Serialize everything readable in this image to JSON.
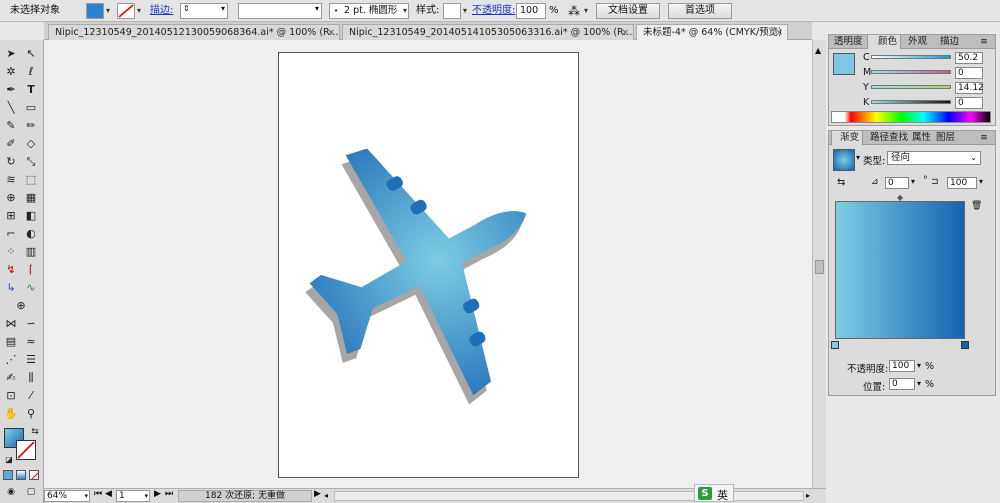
{
  "control_bar": {
    "selection_status": "未选择对象",
    "stroke_label": "描边:",
    "stroke_weight": "",
    "brush_value": "2 pt. 椭圆形",
    "style_label": "样式:",
    "opacity_label": "不透明度:",
    "opacity_value": "100",
    "opacity_unit": "%",
    "doc_setup_button": "文档设置",
    "preferences_button": "首选项"
  },
  "tabs": [
    {
      "label": "Nipic_12310549_20140512130059068364.ai* @ 100% (R...",
      "close": "×"
    },
    {
      "label": "Nipic_12310549_20140514105305063316.ai* @ 100% (R...",
      "close": "×"
    },
    {
      "label": "未标题-4* @ 64% (CMYK/预览)",
      "close": "×"
    }
  ],
  "color_panel": {
    "tabs": [
      "透明度",
      "颜色",
      "外观",
      "描边"
    ],
    "swatch_color": "#7ec8e3",
    "channels": [
      {
        "label": "C",
        "value": "50.2"
      },
      {
        "label": "M",
        "value": "0"
      },
      {
        "label": "Y",
        "value": "14.12"
      },
      {
        "label": "K",
        "value": "0"
      }
    ]
  },
  "gradient_panel": {
    "tabs": [
      "渐变",
      "路径查找",
      "属性",
      "图层"
    ],
    "type_label": "类型:",
    "type_value": "径向",
    "angle_value": "0",
    "degree_unit": "°",
    "aspect_value": "100",
    "opacity_label": "不透明度:",
    "opacity_value": "100",
    "position_label": "位置:",
    "position_value": "0",
    "percent": "%",
    "stop_start_color": "#7ecde3",
    "stop_end_color": "#1563b0"
  },
  "status_bar": {
    "zoom": "64%",
    "page": "1",
    "undo_status": "182 次还原; 无重做"
  },
  "ime": {
    "logo": "S",
    "mode": "英"
  },
  "colors": {
    "plane_light": "#7ecde3",
    "plane_dark": "#1a66b5",
    "plane_shadow": "#a6a6a6",
    "fill_swatch": "#2a82d0"
  }
}
